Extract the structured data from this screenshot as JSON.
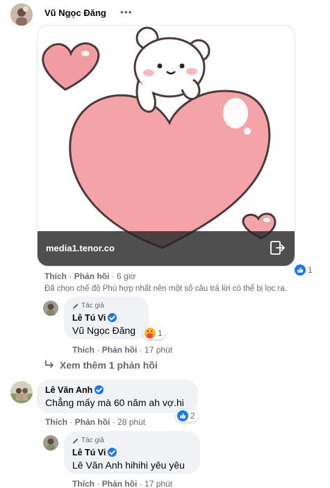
{
  "post": {
    "author": "Vũ Ngọc Đăng",
    "more_label": "•••",
    "gif_source": "media1.tenor.co",
    "reaction_count": "1",
    "actions": {
      "like": "Thích",
      "reply": "Phản hồi",
      "time": "6 giờ"
    },
    "filter_notice": "Đã chọn chế độ Phù hợp nhất nên một số câu trả lời có thể bị lọc ra."
  },
  "reply1": {
    "badge": "Tác giả",
    "author": "Lê Tú Vi",
    "text": "Vũ Ngọc Đăng",
    "reaction_count": "1",
    "actions": {
      "like": "Thích",
      "reply": "Phản hồi",
      "time": "17 phút"
    }
  },
  "see_more": "Xem thêm 1 phản hồi",
  "comment2": {
    "author": "Lê Văn Anh",
    "text": "Chẳng mấy mà 60 năm ah vợ.hi",
    "reaction_count": "2",
    "actions": {
      "like": "Thích",
      "reply": "Phản hồi",
      "time": "28 phút"
    }
  },
  "reply2": {
    "badge": "Tác giả",
    "author": "Lê Tú Vi",
    "text": "Lê Văn Anh hihihi yêu yêu",
    "actions": {
      "like": "Thích",
      "reply": "Phản hồi",
      "time": "17 phút"
    }
  },
  "colors": {
    "accent": "#1877f2",
    "bubble": "#f0f2f5",
    "heart": "#f4a3a8",
    "secondary_text": "#65676b"
  }
}
